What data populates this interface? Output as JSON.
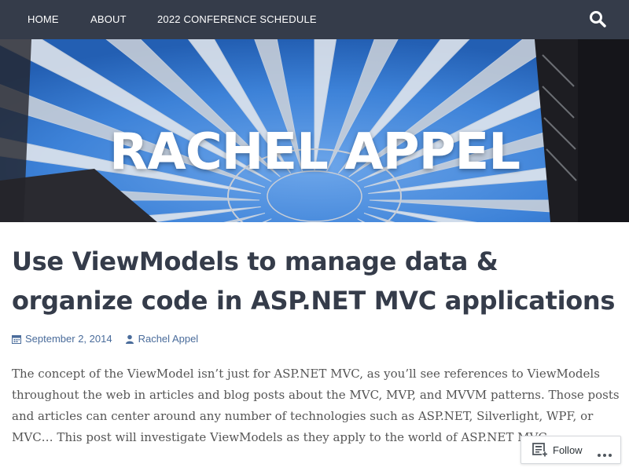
{
  "nav": {
    "items": [
      {
        "label": "HOME"
      },
      {
        "label": "ABOUT"
      },
      {
        "label": "2022 CONFERENCE SCHEDULE"
      }
    ],
    "search_icon": "search-icon"
  },
  "header": {
    "site_title": "RACHEL APPEL"
  },
  "post": {
    "title": "Use ViewModels to manage data & organize code in ASP.NET MVC applications",
    "date": "September 2, 2014",
    "author": "Rachel Appel",
    "excerpt": "The concept of the ViewModel isn’t just for ASP.NET MVC, as you’ll see references to ViewModels throughout the web in articles and blog posts about the MVC, MVP, and MVVM patterns. Those posts and articles can center around any number of technologies such as ASP.NET, Silverlight, WPF, or MVC… This post will investigate ViewModels as they apply to the world of ASP.NET MVC."
  },
  "follow_widget": {
    "label": "Follow",
    "icon": "reader-follow-icon",
    "more_icon": "ellipsis-icon"
  },
  "colors": {
    "nav_background": "#353c4a",
    "title_color": "#353c4a",
    "link_color": "#4a6c9b"
  }
}
